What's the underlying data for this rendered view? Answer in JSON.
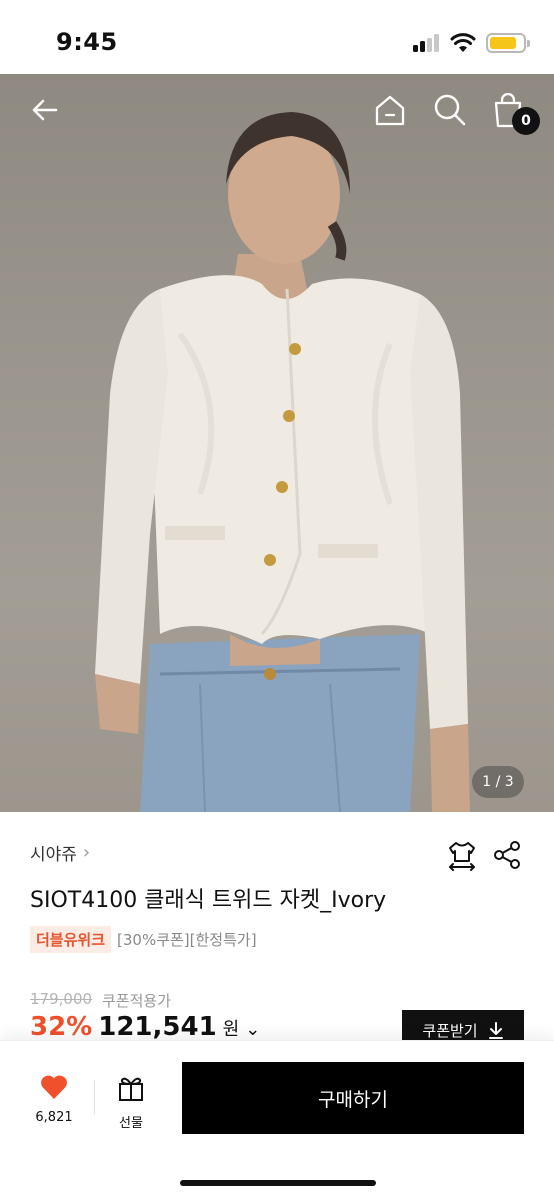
{
  "status_bar": {
    "time": "9:45"
  },
  "header": {
    "back_icon": "arrow-left-icon",
    "home_icon": "home-icon",
    "search_icon": "search-icon",
    "cart_icon": "shopping-bag-icon",
    "cart_count": "0"
  },
  "gallery": {
    "indicator": "1 / 3"
  },
  "product": {
    "brand": "시야쥬",
    "brand_chevron": "›",
    "title": "SIOT4100 클래식 트위드 자켓_Ivory",
    "promo_badge": "더블유위크",
    "promo_tags": "[30%쿠폰][한정특가]",
    "original_price": "179,000",
    "coupon_price_label": "쿠폰적용가",
    "discount_rate": "32%",
    "sale_price": "121,541",
    "currency": "원",
    "price_dropdown": "⌄",
    "coupon_button": "쿠폰받기"
  },
  "actions": {
    "fitting_icon": "clothes-fitting-icon",
    "share_icon": "share-icon"
  },
  "bottom_bar": {
    "like_count": "6,821",
    "gift_label": "선물",
    "buy_label": "구매하기"
  },
  "colors": {
    "accent": "#f0502b",
    "promo_bg": "#fdece6",
    "primary": "#000000",
    "battery": "#f5c518"
  }
}
